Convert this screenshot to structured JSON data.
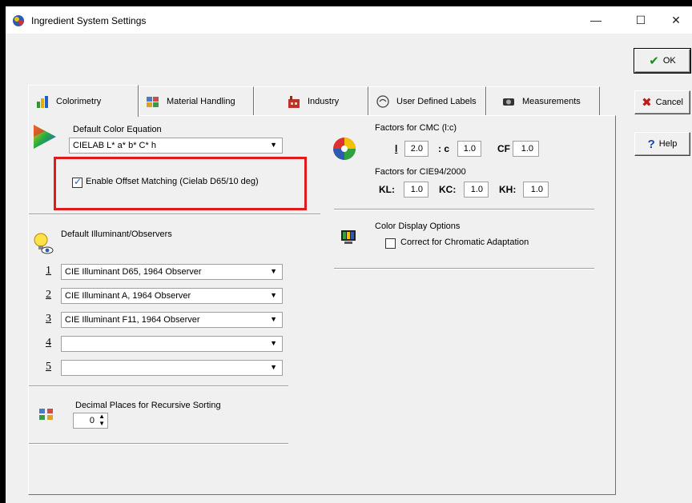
{
  "window": {
    "title": "Ingredient System Settings"
  },
  "window_controls": {
    "minimize": "—",
    "maximize": "☐",
    "close": "✕"
  },
  "actions": {
    "ok": "OK",
    "cancel": "Cancel",
    "help": "Help"
  },
  "tabs": [
    {
      "label": "Colorimetry",
      "active": true
    },
    {
      "label": "Material Handling"
    },
    {
      "label": "Industry"
    },
    {
      "label": "User Defined Labels"
    },
    {
      "label": "Measurements"
    }
  ],
  "color_equation": {
    "label": "Default Color Equation",
    "value": "CIELAB L* a* b* C* h"
  },
  "offset_matching": {
    "label": "Enable Offset Matching (Cielab D65/10 deg)",
    "checked": true
  },
  "illuminants": {
    "label": "Default Illuminant/Observers",
    "items": [
      {
        "num": "1",
        "value": "CIE Illuminant D65, 1964 Observer"
      },
      {
        "num": "2",
        "value": "CIE Illuminant A, 1964 Observer"
      },
      {
        "num": "3",
        "value": "CIE Illuminant F11, 1964 Observer"
      },
      {
        "num": "4",
        "value": ""
      },
      {
        "num": "5",
        "value": ""
      }
    ]
  },
  "decimal_places": {
    "label": "Decimal Places for Recursive Sorting",
    "value": "0"
  },
  "cmc": {
    "label": "Factors for CMC (l:c)",
    "l_label": "l",
    "l_value": "2.0",
    "c_label": ": c",
    "c_value": "1.0",
    "cf_label": "CF",
    "cf_value": "1.0"
  },
  "cie94": {
    "label": "Factors for CIE94/2000",
    "kl_label": "KL:",
    "kl_value": "1.0",
    "kc_label": "KC:",
    "kc_value": "1.0",
    "kh_label": "KH:",
    "kh_value": "1.0"
  },
  "display_options": {
    "label": "Color Display Options",
    "chromatic_label": "Correct for Chromatic Adaptation",
    "chromatic_checked": false
  },
  "colors": {
    "highlight": "#e01b1b",
    "ok_check": "#1a8a1a",
    "cancel_x": "#c01818",
    "help_q": "#1a3fa8"
  }
}
